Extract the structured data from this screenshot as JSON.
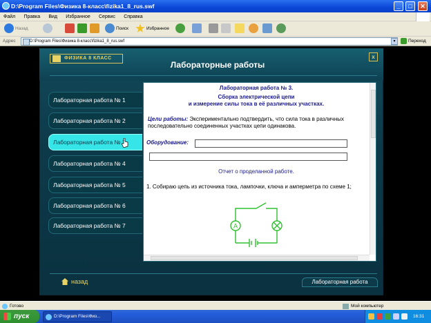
{
  "window": {
    "title": "D:\\Program Files\\Физика 8-класс\\fizika1_8_rus.swf",
    "buttons": {
      "minimize": "_",
      "maximize": "□",
      "close": "✕"
    }
  },
  "menu": [
    "Файл",
    "Правка",
    "Вид",
    "Избранное",
    "Сервис",
    "Справка"
  ],
  "toolbar": {
    "back": "Назад",
    "search": "Поиск",
    "favorites": "Избранное"
  },
  "address": {
    "label": "Адрес",
    "value": "D:\\Program Files\\Физика 8-класс\\fizika1_8_rus.swf",
    "go": "Переход"
  },
  "app": {
    "logo": "ФИЗИКА 8 КЛАСС",
    "title": "Лабораторные работы",
    "close": "x",
    "nav": [
      {
        "label": "Лабораторная работа № 1",
        "active": false
      },
      {
        "label": "Лабораторная работа № 2",
        "active": false
      },
      {
        "label": "Лабораторная работа № 3",
        "active": true
      },
      {
        "label": "Лабораторная работа № 4",
        "active": false
      },
      {
        "label": "Лабораторная работа № 5",
        "active": false
      },
      {
        "label": "Лабораторная работа № 6",
        "active": false
      },
      {
        "label": "Лабораторная работа № 7",
        "active": false
      }
    ],
    "doc": {
      "title": "Лабораторная работа № 3.",
      "subtitle_1": "Сборка электрической цепи",
      "subtitle_2": "и измерение силы тока в её различных участках.",
      "goal_label": "Цели работы:",
      "goal_text": " Экспериментально подтвердить, что сила тока в различных последовательно соединенных  участках цепи одинакова.",
      "equipment_label": "Оборудование:",
      "report": "Отчет о проделанной работе.",
      "step_1": "1. Собираю цепь из источника тока, лампочки, ключа и амперметра по схеме 1;"
    },
    "footer": {
      "back": "назад",
      "tab": "Лабораторная работа"
    }
  },
  "status": {
    "left": "Готово",
    "right": "Мой компьютер"
  },
  "taskbar": {
    "start": "пуск",
    "item": "D:\\Program Files\\Физ...",
    "clock": "16:31"
  },
  "colors": {
    "app_bg": "#0d3a49",
    "accent_gold": "#e9d365",
    "active_tab": "#36e5e8",
    "doc_text": "#1a1a8c",
    "circuit": "#2ec02e"
  }
}
